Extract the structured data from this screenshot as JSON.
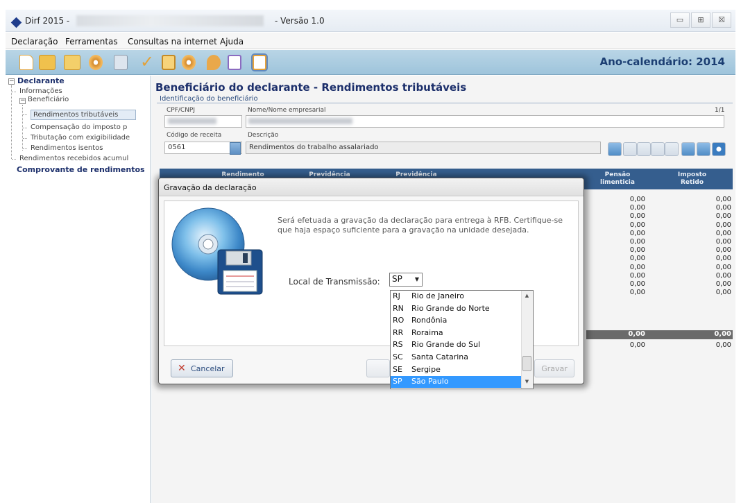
{
  "window": {
    "title": "Dirf 2015 -",
    "version": "- Versão 1.0",
    "controls": {
      "minimize": "▭",
      "maximize": "⊞",
      "close": "☒"
    }
  },
  "menu": {
    "items": [
      "Declaração",
      "Ferramentas",
      "Consultas na internet",
      "Ajuda"
    ]
  },
  "toolbar": {
    "year_label": "Ano-calendário: 2014"
  },
  "sidebar": {
    "declarante": "Declarante",
    "informacoes": "Informações",
    "beneficiario": "Beneficiário",
    "rendimentos_tributaveis": "Rendimentos tributáveis",
    "compensacao": "Compensação do imposto p",
    "tributacao": "Tributação com exigibilidade",
    "rendimentos_isentos": "Rendimentos isentos",
    "rendimentos_acumulados": "Rendimentos recebidos acumul",
    "comprovante": "Comprovante de rendimentos"
  },
  "main": {
    "title": "Beneficiário do declarante - Rendimentos tributáveis",
    "section": "Identificação do beneficiário",
    "cpf_label": "CPF/CNPJ",
    "nome_label": "Nome/Nome empresarial",
    "page_count": "1/1",
    "codigo_label": "Código de receita",
    "codigo_value": "0561",
    "descricao_label": "Descrição",
    "descricao_value": "Rendimentos do trabalho assalariado"
  },
  "table": {
    "headers": [
      "Rendimento",
      "Previdência",
      "Previdência",
      "Pensão\nlimenticia",
      "Imposto\nRetido"
    ],
    "rows": [
      [
        "0,00",
        "0,00"
      ],
      [
        "0,00",
        "0,00"
      ],
      [
        "0,00",
        "0,00"
      ],
      [
        "0,00",
        "0,00"
      ],
      [
        "0,00",
        "0,00"
      ],
      [
        "0,00",
        "0,00"
      ],
      [
        "0,00",
        "0,00"
      ],
      [
        "0,00",
        "0,00"
      ],
      [
        "0,00",
        "0,00"
      ],
      [
        "0,00",
        "0,00"
      ],
      [
        "0,00",
        "0,00"
      ],
      [
        "0,00",
        "0,00"
      ]
    ],
    "total": [
      "0,00",
      "0,00"
    ],
    "last_row": [
      "0,00",
      "0,00"
    ]
  },
  "dialog": {
    "title": "Gravação da declaração",
    "message": "Será efetuada a gravação da declaração para entrega à RFB. Certifique-se que haja espaço suficiente para a gravação na unidade desejada.",
    "local_label": "Local de Transmissão:",
    "selected_state": "SP",
    "options": [
      {
        "code": "RJ",
        "name": "Rio de Janeiro"
      },
      {
        "code": "RN",
        "name": "Rio Grande do Norte"
      },
      {
        "code": "RO",
        "name": "Rondônia"
      },
      {
        "code": "RR",
        "name": "Roraima"
      },
      {
        "code": "RS",
        "name": "Rio Grande do Sul"
      },
      {
        "code": "SC",
        "name": "Santa Catarina"
      },
      {
        "code": "SE",
        "name": "Sergipe"
      },
      {
        "code": "SP",
        "name": "São Paulo"
      }
    ],
    "cancel_label": "Cancelar",
    "ok_label": "Gravar"
  },
  "colors": {
    "title_blue": "#1c2f6b",
    "toolbar": "#a9cbe0",
    "table_header": "#355e8e",
    "selection": "#3399ff"
  }
}
